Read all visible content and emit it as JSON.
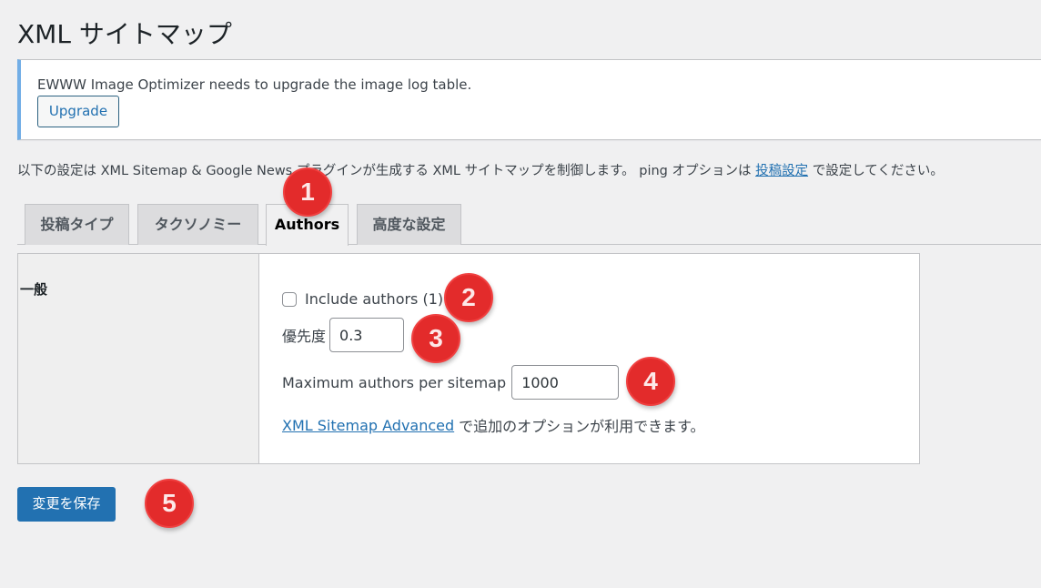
{
  "page": {
    "title": "XML サイトマップ"
  },
  "notice": {
    "text": "EWWW Image Optimizer needs to upgrade the image log table.",
    "button_label": "Upgrade"
  },
  "intro": {
    "text_before": "以下の設定は XML Sitemap & Google News プラグインが生成する XML サイトマップを制御します。 ping オプションは ",
    "link_text": "投稿設定",
    "text_after": " で設定してください。"
  },
  "tabs": [
    {
      "label": "投稿タイプ",
      "active": false
    },
    {
      "label": "タクソノミー",
      "active": false
    },
    {
      "label": "Authors",
      "active": true
    },
    {
      "label": "高度な設定",
      "active": false
    }
  ],
  "form": {
    "section_label": "一般",
    "include_authors": {
      "label": "Include authors (1)",
      "checked": false
    },
    "priority": {
      "label": "優先度",
      "value": "0.3"
    },
    "max_authors": {
      "label": "Maximum authors per sitemap",
      "value": "1000"
    },
    "advanced_note": {
      "link_text": "XML Sitemap Advanced",
      "text": "で追加のオプションが利用できます。"
    }
  },
  "save_button": {
    "label": "変更を保存"
  },
  "markers": [
    "1",
    "2",
    "3",
    "4",
    "5"
  ],
  "colors": {
    "accent": "#2271b1",
    "notice_border": "#72aee6",
    "marker": "#e32b2b",
    "background": "#f0f0f1"
  }
}
